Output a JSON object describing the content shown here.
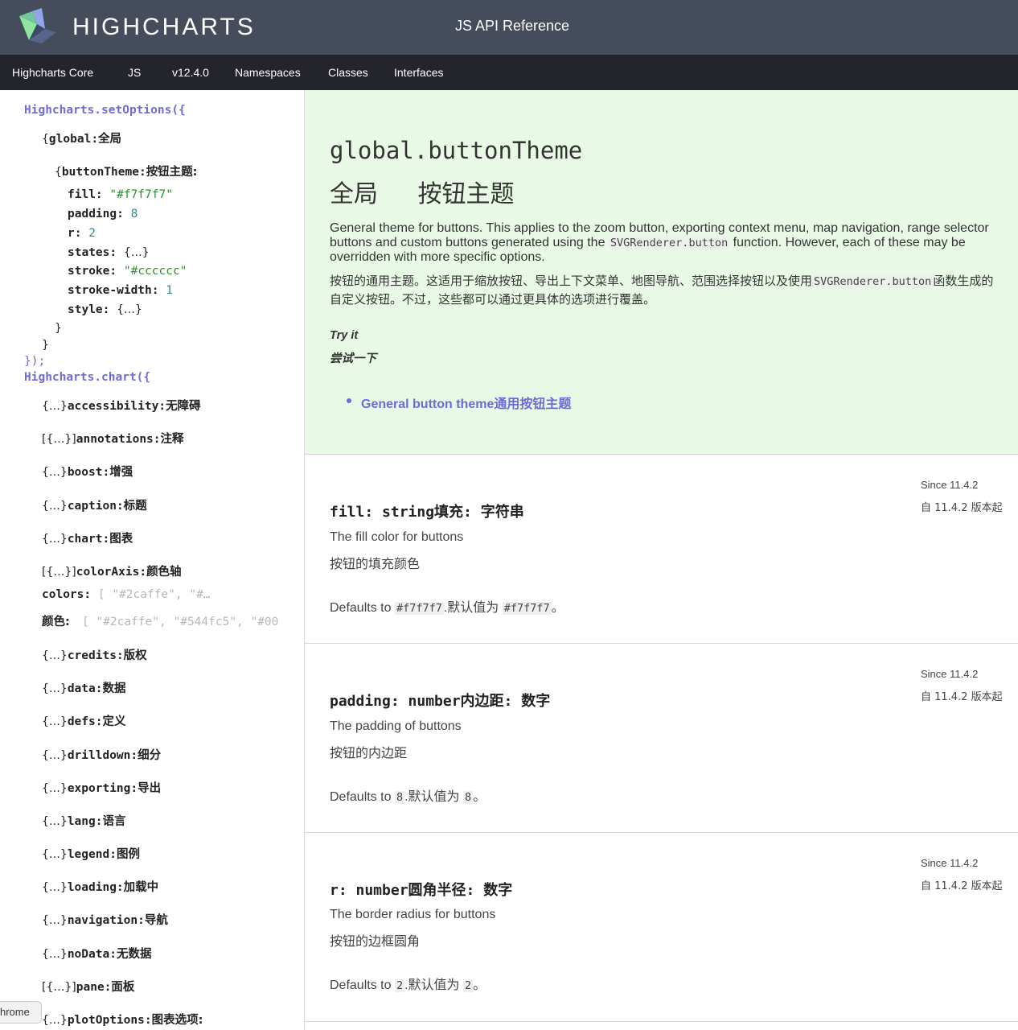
{
  "header": {
    "brand": "HIGHCHARTS",
    "title": "JS API Reference"
  },
  "nav": [
    "Highcharts Core",
    "JS",
    "v12.4.0",
    "Namespaces",
    "Classes",
    "Interfaces"
  ],
  "sidebar": {
    "set_options": "Highcharts.setOptions({",
    "global_key": "global",
    "global_cn": "全局",
    "button_theme_key": "buttonTheme",
    "button_theme_cn": "按钮主题:",
    "props": [
      {
        "key": "fill",
        "value": "\"#f7f7f7\"",
        "kind": "str"
      },
      {
        "key": "padding",
        "value": "8",
        "kind": "num"
      },
      {
        "key": "r",
        "value": "2",
        "kind": "num"
      },
      {
        "key": "states",
        "value": "{…}",
        "kind": "obj"
      },
      {
        "key": "stroke",
        "value": "\"#cccccc\"",
        "kind": "str"
      },
      {
        "key": "stroke-width",
        "value": "1",
        "kind": "num"
      },
      {
        "key": "style",
        "value": "{…}",
        "kind": "obj"
      }
    ],
    "close1": "}",
    "close2": "}",
    "close3": "});",
    "chart_open": "Highcharts.chart({",
    "items": [
      {
        "brace": "{…}",
        "key": "accessibility",
        "cn": "无障碍"
      },
      {
        "brace": "[{…}]",
        "key": "annotations",
        "cn": "注释"
      },
      {
        "brace": "{…}",
        "key": "boost",
        "cn": "增强"
      },
      {
        "brace": "{…}",
        "key": "caption",
        "cn": "标题"
      },
      {
        "brace": "{…}",
        "key": "chart",
        "cn": "图表"
      },
      {
        "brace": "[{…}]",
        "key": "colorAxis",
        "cn": "颜色轴"
      }
    ],
    "colors_key": "colors",
    "colors_value": "[ \"#2caffe\", \"#…",
    "colors_cn": "颜色",
    "colors_cn_value": "[ \"#2caffe\", \"#544fc5\", \"#00",
    "items2": [
      {
        "brace": "{…}",
        "key": "credits",
        "cn": "版权"
      },
      {
        "brace": "{…}",
        "key": "data",
        "cn": "数据"
      },
      {
        "brace": "{…}",
        "key": "defs",
        "cn": "定义"
      },
      {
        "brace": "{…}",
        "key": "drilldown",
        "cn": "细分"
      },
      {
        "brace": "{…}",
        "key": "exporting",
        "cn": "导出"
      },
      {
        "brace": "{…}",
        "key": "lang",
        "cn": "语言"
      },
      {
        "brace": "{…}",
        "key": "legend",
        "cn": "图例"
      },
      {
        "brace": "{…}",
        "key": "loading",
        "cn": "加载中"
      },
      {
        "brace": "{…}",
        "key": "navigation",
        "cn": "导航"
      },
      {
        "brace": "{…}",
        "key": "noData",
        "cn": "无数据"
      },
      {
        "brace": "[{…}]",
        "key": "pane",
        "cn": "面板"
      },
      {
        "brace": "{…}",
        "key": "plotOptions",
        "cn": "图表选项:"
      }
    ],
    "chrome_tag": "hrome"
  },
  "hero": {
    "title": "global.buttonTheme",
    "title_cn_1": "全局",
    "title_cn_2": "按钮主题",
    "desc_a": "General theme for buttons. This applies to the zoom button, exporting context menu, map navigation, range selector buttons and custom buttons generated using the ",
    "desc_code": "SVGRenderer.button",
    "desc_b": " function. However, each of these may be overridden with more specific options.",
    "desc_cn_a": "按钮的通用主题。这适用于缩放按钮、导出上下文菜单、地图导航、范围选择按钮以及使用",
    "desc_cn_code": "SVGRenderer.button",
    "desc_cn_b": "函数生成的自定义按钮。不过，这些都可以通过更具体的选项进行覆盖。",
    "try_it": "Try it",
    "try_it_cn": "尝试一下",
    "link": "General button theme通用按钮主题"
  },
  "options": [
    {
      "since": "Since 11.4.2",
      "since_cn": "自 11.4.2 版本起",
      "title": "fill: string填充: 字符串",
      "desc": "The fill color for buttons",
      "desc_cn": "按钮的填充颜色",
      "def_a": "Defaults to ",
      "def_code": "#f7f7f7",
      "def_b": ".默认值为 ",
      "def_code2": "#f7f7f7",
      "def_c": "。"
    },
    {
      "since": "Since 11.4.2",
      "since_cn": "自 11.4.2 版本起",
      "title": "padding: number内边距: 数字",
      "desc": "The padding of buttons",
      "desc_cn": "按钮的内边距",
      "def_a": "Defaults to ",
      "def_code": "8",
      "def_b": ".默认值为 ",
      "def_code2": "8",
      "def_c": "。"
    },
    {
      "since": "Since 11.4.2",
      "since_cn": "自 11.4.2 版本起",
      "title": "r: number圆角半径: 数字",
      "desc": "The border radius for buttons",
      "desc_cn": "按钮的边框圆角",
      "def_a": "Defaults to ",
      "def_code": "2",
      "def_b": ".默认值为 ",
      "def_code2": "2",
      "def_c": "。"
    }
  ]
}
